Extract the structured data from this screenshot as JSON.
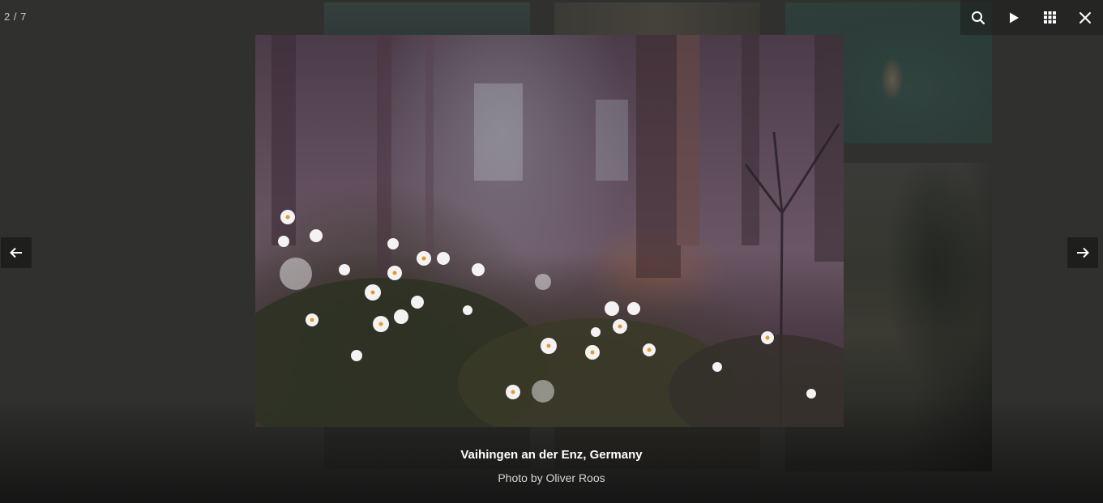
{
  "lightbox": {
    "counter": "2 / 7",
    "caption": {
      "title": "Vaihingen an der Enz, Germany",
      "credit": "Photo by Oliver Roos"
    },
    "toolbar": [
      {
        "name": "zoom",
        "icon": "search-icon"
      },
      {
        "name": "slideshow",
        "icon": "play-icon"
      },
      {
        "name": "thumbnails",
        "icon": "grid-icon"
      },
      {
        "name": "close",
        "icon": "close-icon"
      }
    ],
    "navigation": {
      "prev_icon": "arrow-left-icon",
      "next_icon": "arrow-right-icon"
    },
    "colors": {
      "overlay": "#30302e",
      "icon": "#ffffff",
      "nav_background": "#1e1e1d"
    }
  }
}
